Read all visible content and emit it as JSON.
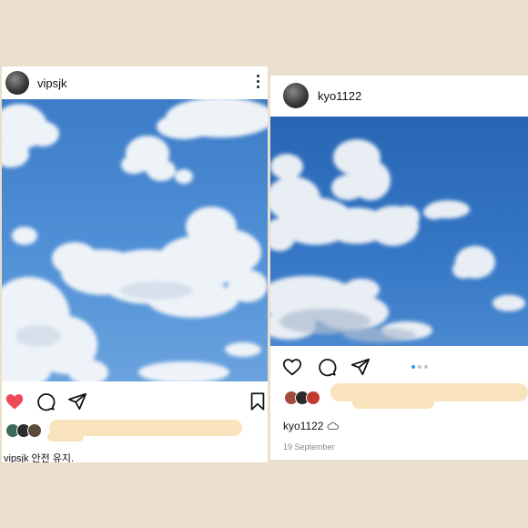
{
  "left_post": {
    "username": "vipsjk",
    "caption_user": "vipsjk",
    "caption_text": "안전 유지.",
    "liked": true
  },
  "right_post": {
    "username": "kyo1122",
    "owner_line_user": "kyo1122",
    "date": "19 September",
    "carousel_index": 1,
    "carousel_count": 3
  },
  "colors": {
    "background": "#e9dfcc",
    "like_red": "#ed4956",
    "sky_blue": "#2f74c4",
    "carousel_active": "#3897f0"
  },
  "icons": [
    "more-icon",
    "heart-icon",
    "comment-icon",
    "share-icon",
    "bookmark-icon",
    "cloud-icon"
  ]
}
